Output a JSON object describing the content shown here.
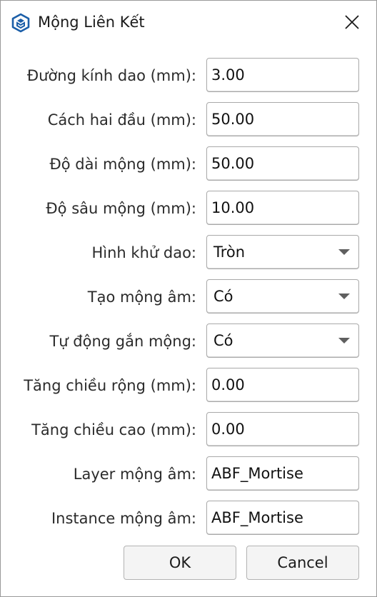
{
  "window": {
    "title": "Mộng Liên Kết",
    "close_glyph": "✕"
  },
  "form": {
    "fields": [
      {
        "label": "Đường kính dao (mm):",
        "type": "input",
        "value": "3.00"
      },
      {
        "label": "Cách hai đầu (mm):",
        "type": "input",
        "value": "50.00"
      },
      {
        "label": "Độ dài mộng (mm):",
        "type": "input",
        "value": "50.00"
      },
      {
        "label": "Độ sâu mộng (mm):",
        "type": "input",
        "value": "10.00"
      },
      {
        "label": "Hình khử dao:",
        "type": "select",
        "value": "Tròn"
      },
      {
        "label": "Tạo mộng âm:",
        "type": "select",
        "value": "Có"
      },
      {
        "label": "Tự động gắn mộng:",
        "type": "select",
        "value": "Có"
      },
      {
        "label": "Tăng chiều rộng (mm):",
        "type": "input",
        "value": "0.00"
      },
      {
        "label": "Tăng chiều cao (mm):",
        "type": "input",
        "value": "0.00"
      },
      {
        "label": "Layer mộng âm:",
        "type": "input",
        "value": "ABF_Mortise"
      },
      {
        "label": "Instance mộng âm:",
        "type": "input",
        "value": "ABF_Mortise"
      }
    ]
  },
  "buttons": {
    "ok": "OK",
    "cancel": "Cancel"
  },
  "colors": {
    "app_icon": "#1b5ea8",
    "border": "#a9a9a9",
    "button_bg": "#f4f4f4"
  }
}
